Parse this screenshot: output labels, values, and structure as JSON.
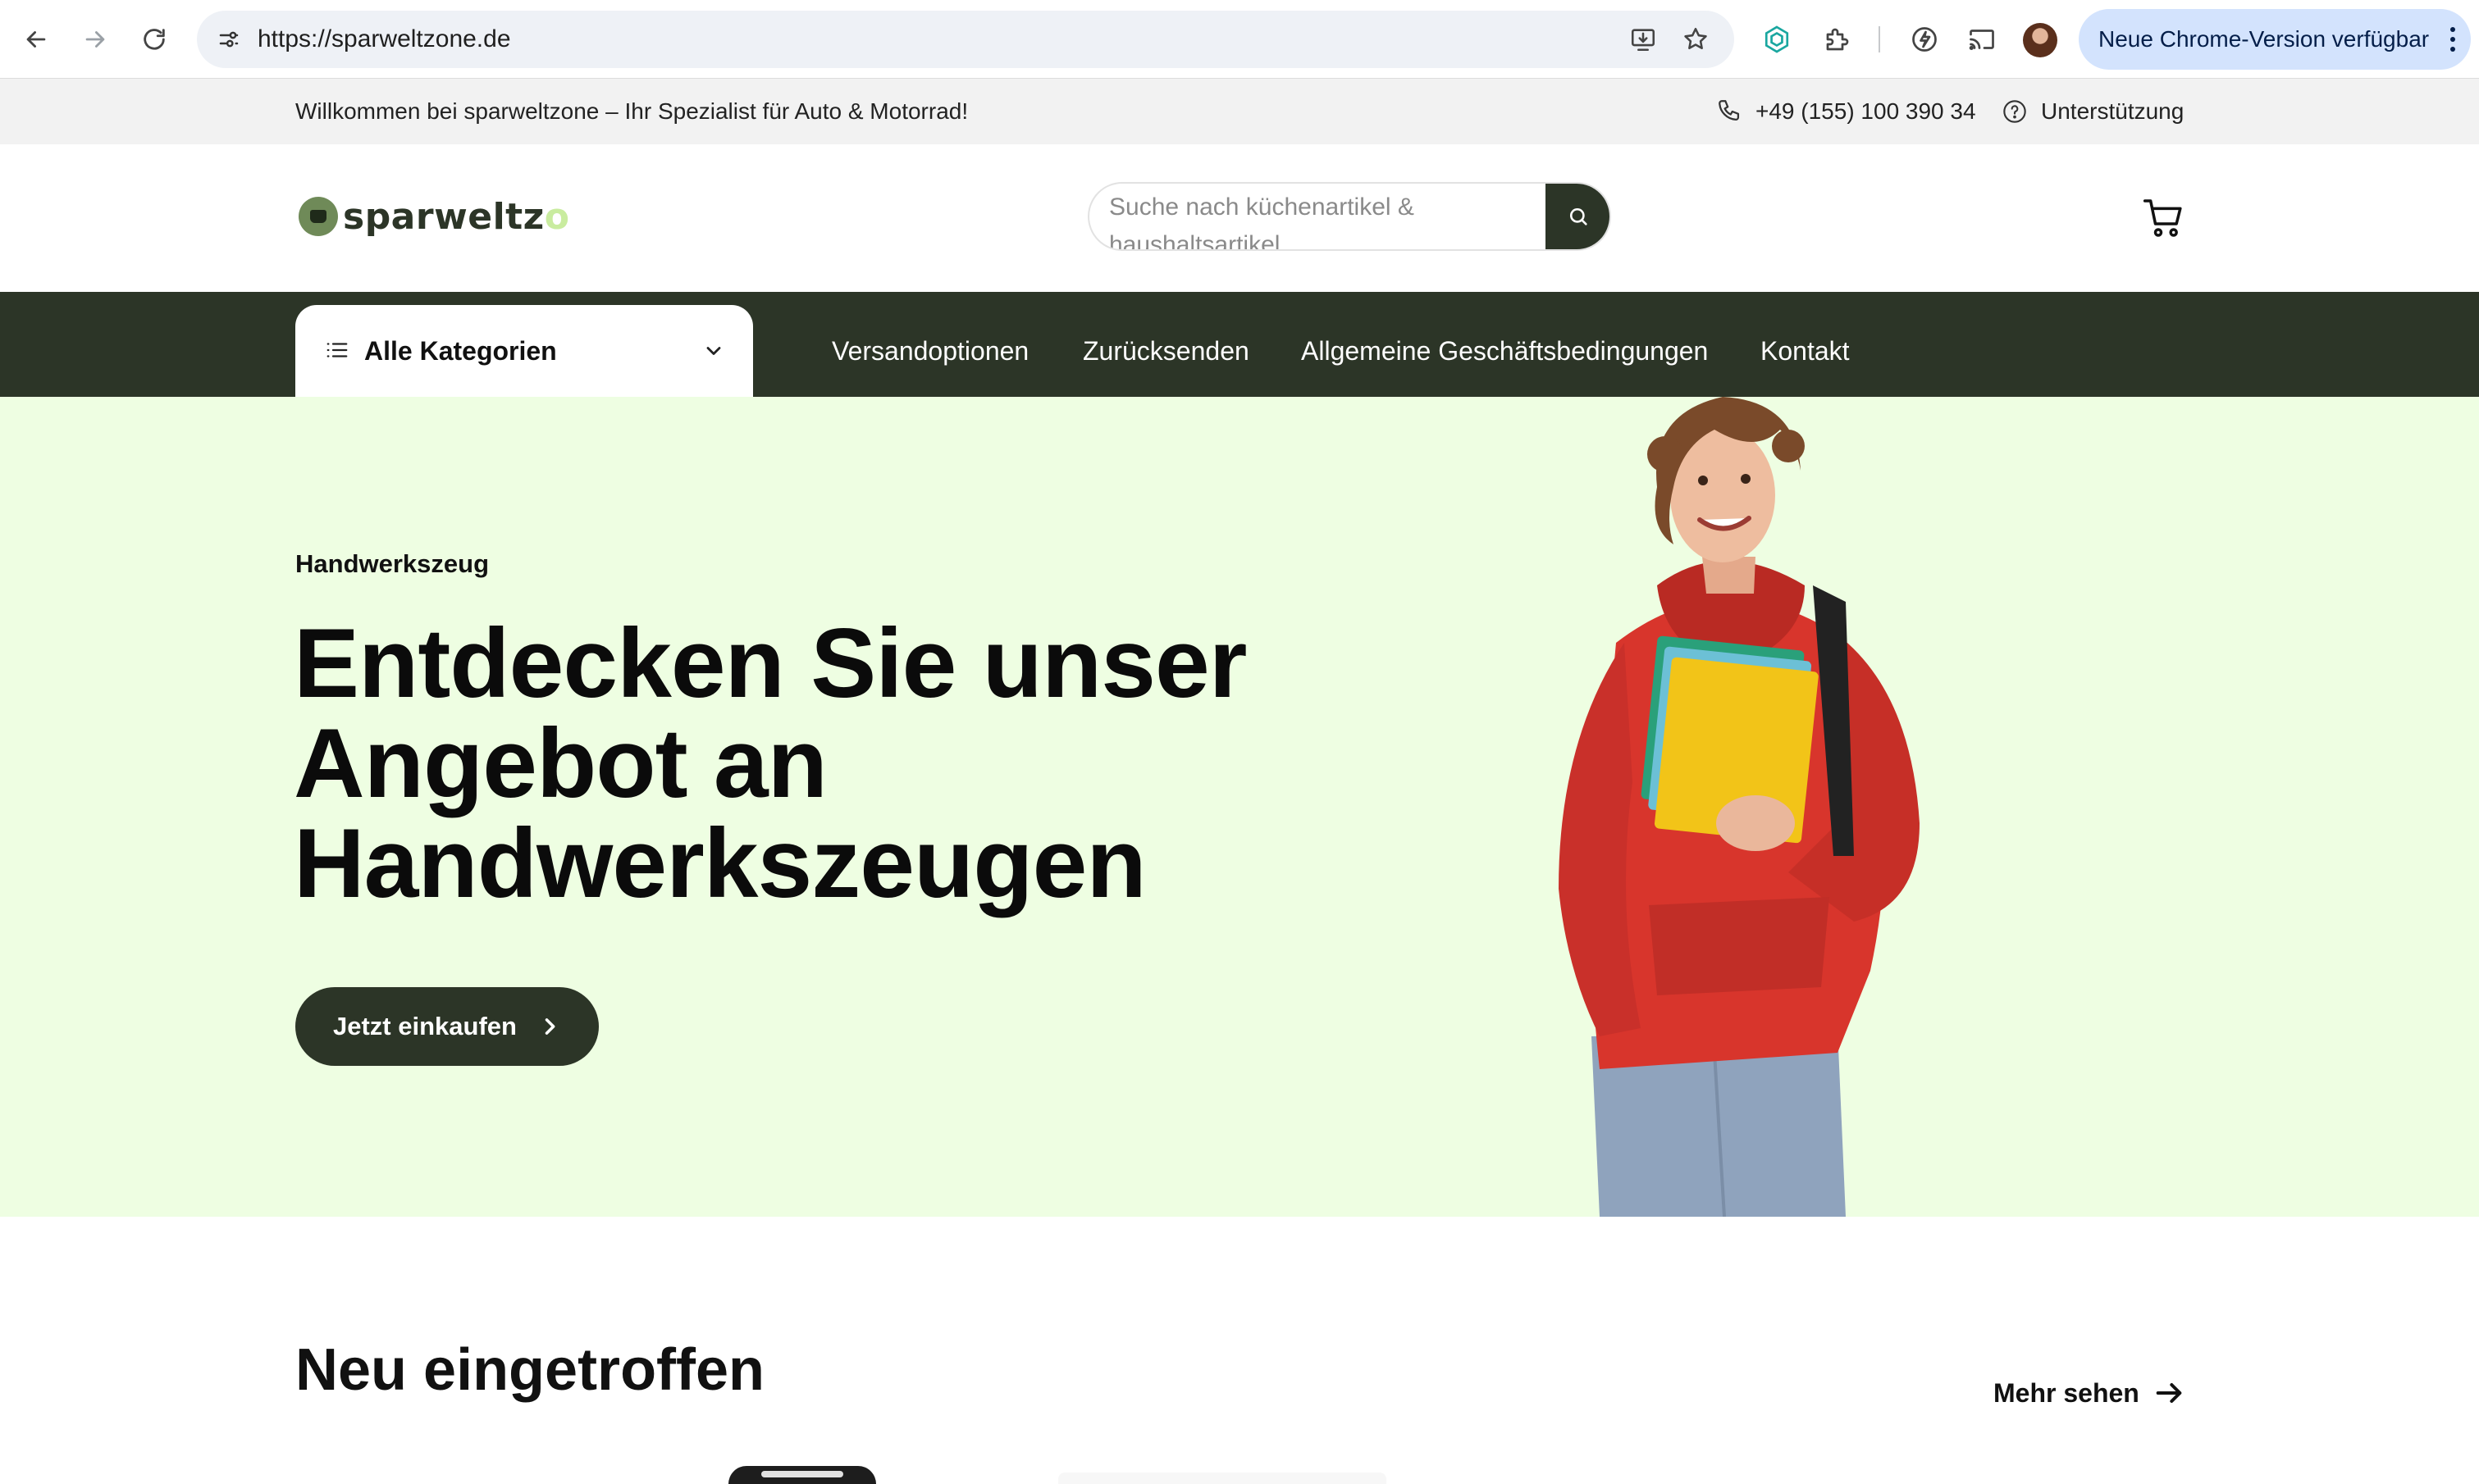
{
  "browser": {
    "url": "https://sparweltzone.de",
    "update_label": "Neue Chrome-Version verfügbar",
    "icons": [
      "back-icon",
      "forward-icon",
      "reload-icon",
      "site-info-icon",
      "install-icon",
      "bookmark-star-icon",
      "extension-ai-icon",
      "extensions-puzzle-icon",
      "performance-icon",
      "cast-icon",
      "profile-avatar",
      "menu-dots-icon"
    ]
  },
  "topbar": {
    "welcome": "Willkommen bei sparweltzone – Ihr Spezialist für Auto & Motorrad!",
    "phone": "+49 (155) 100 390 34",
    "support": "Unterstützung"
  },
  "header": {
    "logo_text": "sparweltz",
    "logo_tail": "o",
    "search_placeholder": "Suche nach küchenartikel & haushaltsartikel",
    "icons": [
      "search-icon",
      "cart-icon"
    ]
  },
  "nav": {
    "categories_label": "Alle Kategorien",
    "links": [
      "Versandoptionen",
      "Zurücksenden",
      "Allgemeine Geschäftsbedingungen",
      "Kontakt"
    ]
  },
  "hero": {
    "kicker": "Handwerkszeug",
    "title": "Entdecken Sie unser Angebot an Handwerkszeugen",
    "cta": "Jetzt einkaufen",
    "background": "#eefee2"
  },
  "new_arrivals": {
    "title": "Neu eingetroffen",
    "more": "Mehr sehen"
  },
  "colors": {
    "brand_dark": "#2c3527",
    "brand_light": "#c9ec9f",
    "chrome_update_pill": "#d3e3fd"
  }
}
